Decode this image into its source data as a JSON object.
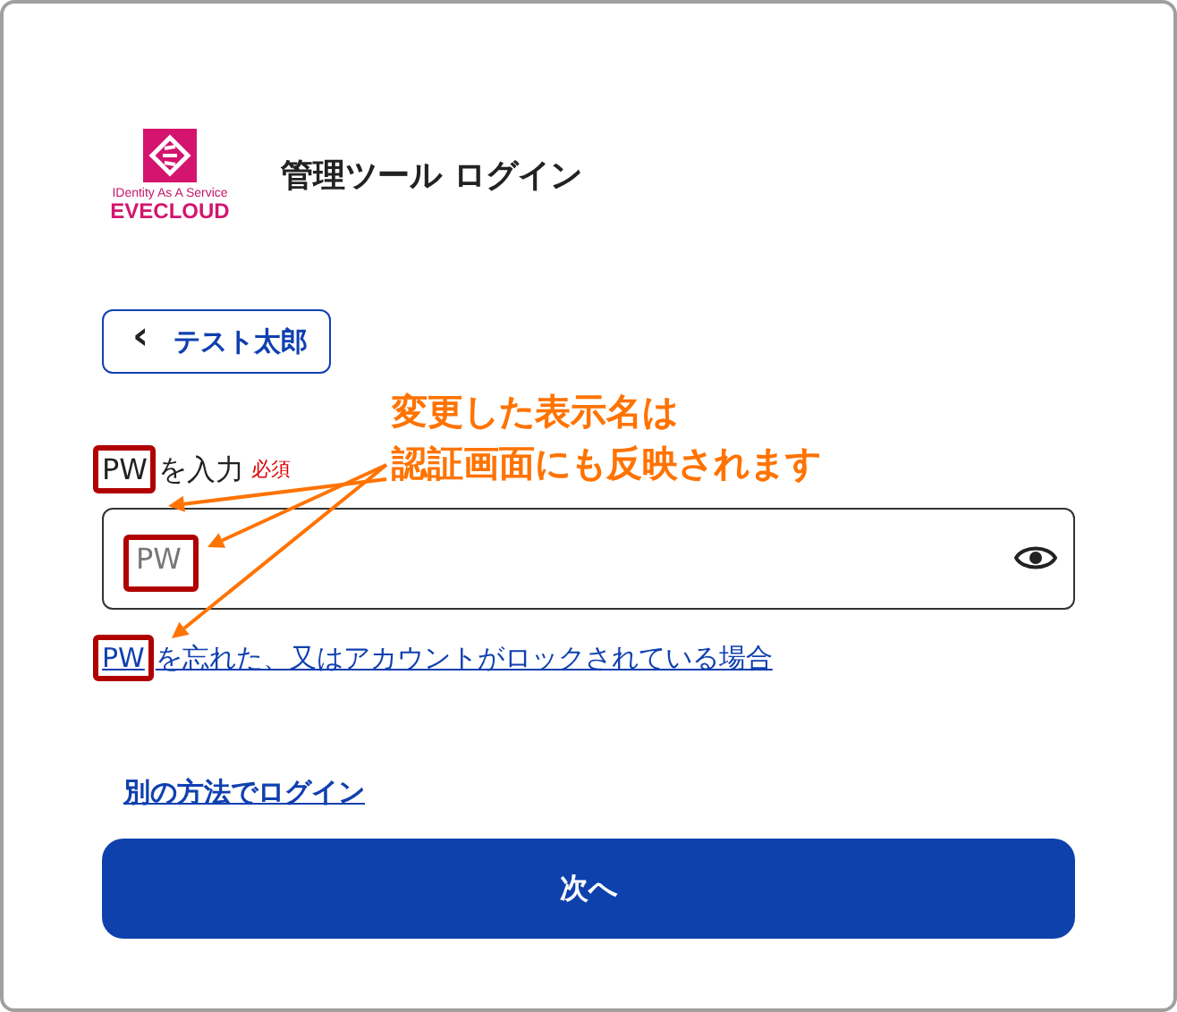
{
  "logo": {
    "tagline": "IDentity As A Service",
    "name": "EVECLOUD"
  },
  "title": "管理ツール ログイン",
  "back_button": {
    "icon": "‹",
    "label": "テスト太郎"
  },
  "field": {
    "label_highlight": "PW",
    "label_rest": "を入力",
    "required": "必須",
    "placeholder": "PW"
  },
  "forgot_link": {
    "highlight": "PW",
    "rest": "を忘れた、又はアカウントがロックされている場合"
  },
  "alt_login_link": "別の方法でログイン",
  "next_button": "次へ",
  "annotation": {
    "lines": [
      "変更した表示名は",
      "認証画面にも反映されます"
    ]
  }
}
